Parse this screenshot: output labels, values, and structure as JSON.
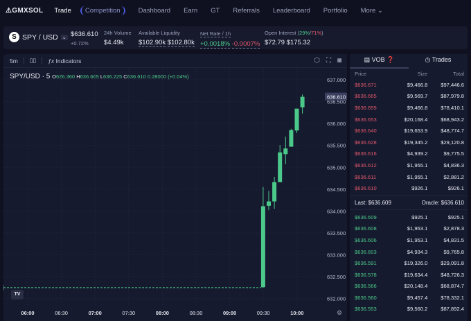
{
  "nav": {
    "logo": "GMXSOL",
    "items": [
      "Trade",
      "Competition",
      "Dashboard",
      "Earn",
      "GT",
      "Referrals",
      "Leaderboard",
      "Portfolio",
      "More ⌄"
    ]
  },
  "market": {
    "symbol": "SPY / USD",
    "price": "$636.610",
    "change": "+0.72%",
    "vol_label": "24h Volume",
    "vol": "$4.49k",
    "liq_label": "Available Liquidity",
    "liq_long": "$102.90k",
    "liq_short": "$102.80k",
    "rate_label": "Net Rate / 1h",
    "rate_long": "+0.0018%",
    "rate_short": "-0.0007%",
    "oi_label": "Open Interest (",
    "oi_long_pct": "29%",
    "oi_slash": "/",
    "oi_short_pct": "71%",
    "oi_close": ")",
    "oi_long": "$72.79",
    "oi_short": "$175.32"
  },
  "chart": {
    "interval": "5m",
    "indicators": "Indicators",
    "title": "SPY/USD · 5",
    "o": "636.360",
    "h": "636.665",
    "l": "636.225",
    "c": "636.610",
    "chg": "0.28000 (+0.04%)",
    "last_label": "636.610",
    "tv": "TV"
  },
  "chart_data": {
    "type": "candlestick",
    "ylim": [
      632.0,
      637.0
    ],
    "yticks": [
      "637.000",
      "636.500",
      "636.000",
      "635.500",
      "635.000",
      "634.500",
      "634.000",
      "633.500",
      "633.000",
      "632.500",
      "632.000"
    ],
    "xticks": [
      "06:00",
      "06:30",
      "07:00",
      "07:30",
      "08:00",
      "08:30",
      "09:00",
      "09:30",
      "10:00"
    ],
    "flat_price": 632.25,
    "candles": [
      {
        "t": "09:30",
        "o": 632.26,
        "h": 634.55,
        "l": 632.25,
        "c": 634.11
      },
      {
        "t": "09:35",
        "o": 634.12,
        "h": 634.46,
        "l": 634.02,
        "c": 634.22
      },
      {
        "t": "09:40",
        "o": 634.22,
        "h": 634.78,
        "l": 634.05,
        "c": 634.66
      },
      {
        "t": "09:45",
        "o": 634.66,
        "h": 635.51,
        "l": 634.66,
        "c": 635.34
      },
      {
        "t": "09:50",
        "o": 635.3,
        "h": 635.7,
        "l": 635.07,
        "c": 635.43
      },
      {
        "t": "09:55",
        "o": 635.47,
        "h": 635.88,
        "l": 635.47,
        "c": 635.85
      },
      {
        "t": "10:00",
        "o": 635.84,
        "h": 636.34,
        "l": 635.78,
        "c": 636.34
      },
      {
        "t": "10:05",
        "o": 636.37,
        "h": 636.665,
        "l": 636.225,
        "c": 636.61
      }
    ]
  },
  "orderbook": {
    "tab_vob": "VOB",
    "tab_trades": "Trades",
    "headers": [
      "Price",
      "Size",
      "Total"
    ],
    "asks": [
      [
        "$636.671",
        "$9,466.8",
        "$97,446.6"
      ],
      [
        "$636.665",
        "$9,569.7",
        "$87,979.8"
      ],
      [
        "$636.659",
        "$9,466.8",
        "$78,410.1"
      ],
      [
        "$636.653",
        "$20,168.4",
        "$68,943.2"
      ],
      [
        "$636.640",
        "$19,653.9",
        "$48,774.7"
      ],
      [
        "$636.628",
        "$19,345.2",
        "$29,120.8"
      ],
      [
        "$636.616",
        "$4,939.2",
        "$9,775.5"
      ],
      [
        "$636.612",
        "$1,955.1",
        "$4,836.3"
      ],
      [
        "$636.611",
        "$1,955.1",
        "$2,881.2"
      ],
      [
        "$636.610",
        "$926.1",
        "$926.1"
      ]
    ],
    "last": "Last: $636.609",
    "oracle": "Oracle: $636.610",
    "bids": [
      [
        "$636.609",
        "$925.1",
        "$925.1"
      ],
      [
        "$636.608",
        "$1,953.1",
        "$2,878.3"
      ],
      [
        "$636.606",
        "$1,953.1",
        "$4,831.5"
      ],
      [
        "$636.603",
        "$4,934.3",
        "$9,765.8"
      ],
      [
        "$636.591",
        "$19,326.0",
        "$29,091.8"
      ],
      [
        "$636.578",
        "$19,634.4",
        "$48,726.3"
      ],
      [
        "$636.566",
        "$20,148.4",
        "$68,874.7"
      ],
      [
        "$636.560",
        "$9,457.4",
        "$78,332.1"
      ],
      [
        "$636.553",
        "$9,560.2",
        "$87,892.4"
      ]
    ]
  },
  "colors": {
    "up": "#4bc98a",
    "down": "#e0576a",
    "bg": "#0f1120"
  }
}
